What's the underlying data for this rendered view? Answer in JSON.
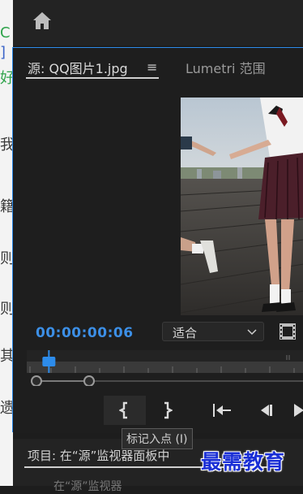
{
  "colors": {
    "accent": "#2d8ceb",
    "timecode": "#3c8fe6",
    "panel_bg": "#1e1e1e",
    "watermark": "#1a2fd6"
  },
  "left_strip": {
    "glyphs": [
      "C",
      "]",
      "好",
      "我",
      "籍",
      "则",
      "则",
      "其",
      "遗"
    ]
  },
  "header": {
    "home_icon": "home-icon"
  },
  "source_panel": {
    "tab_source": "源: QQ图片1.jpg",
    "tab_menu_icon": "≡",
    "tab_lumetri": "Lumetri 范围",
    "timecode": "00:00:00:06",
    "fit_select": {
      "selected": "适合",
      "icon": "chevron-down-icon"
    },
    "export_frame_icon": "film-icon",
    "playhead_fraction": 0.08,
    "controls": [
      {
        "name": "mark-in-button",
        "icon": "mark-in-icon"
      },
      {
        "name": "mark-out-button",
        "icon": "mark-out-icon"
      },
      {
        "name": "go-to-in-button",
        "icon": "go-to-in-icon"
      },
      {
        "name": "step-back-button",
        "icon": "step-back-icon"
      },
      {
        "name": "play-button",
        "icon": "play-icon"
      }
    ],
    "tooltip": "标记入点 (I)"
  },
  "project_panel": {
    "label": "项目: 在“源”监视器面板中",
    "bottom_text": "在“源”监视器"
  },
  "watermark": "最需教育"
}
